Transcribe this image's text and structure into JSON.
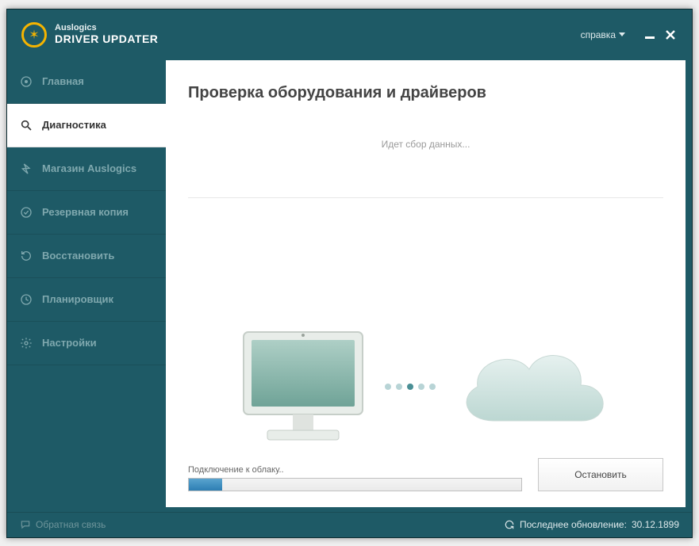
{
  "header": {
    "brand_small": "Auslogics",
    "brand_big": "DRIVER UPDATER",
    "help_label": "справка"
  },
  "sidebar": {
    "items": [
      {
        "label": "Главная",
        "icon": "target-icon",
        "active": false
      },
      {
        "label": "Диагностика",
        "icon": "search-icon",
        "active": true
      },
      {
        "label": "Магазин Auslogics",
        "icon": "bolt-icon",
        "active": false
      },
      {
        "label": "Резервная копия",
        "icon": "check-icon",
        "active": false
      },
      {
        "label": "Восстановить",
        "icon": "restore-icon",
        "active": false
      },
      {
        "label": "Планировщик",
        "icon": "clock-icon",
        "active": false
      },
      {
        "label": "Настройки",
        "icon": "gear-icon",
        "active": false
      }
    ]
  },
  "main": {
    "heading": "Проверка оборудования и драйверов",
    "status_text": "Идет сбор данных...",
    "progress_label": "Подключение к облаку..",
    "progress_pct": 10,
    "stop_label": "Остановить"
  },
  "statusbar": {
    "feedback_label": "Обратная связь",
    "last_update_prefix": "Последнее обновление:",
    "last_update_value": "30.12.1899"
  }
}
